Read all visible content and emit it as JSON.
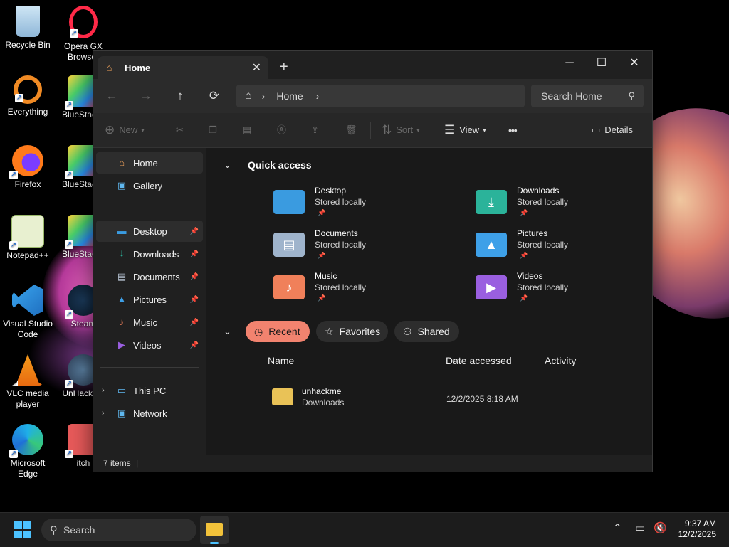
{
  "desktop": {
    "icons": [
      {
        "label": "Recycle Bin",
        "icon": "recycle-bin-icon"
      },
      {
        "label": "Opera GX Browser",
        "icon": "opera-gx-icon"
      },
      {
        "label": "Everything",
        "icon": "everything-search-icon"
      },
      {
        "label": "BlueStacks",
        "icon": "bluestacks-icon"
      },
      {
        "label": "Firefox",
        "icon": "firefox-icon"
      },
      {
        "label": "BlueStacks",
        "icon": "bluestacks-icon"
      },
      {
        "label": "Notepad++",
        "icon": "notepad-plus-plus-icon"
      },
      {
        "label": "BlueStacks",
        "icon": "bluestacks-icon"
      },
      {
        "label": "Visual Studio Code",
        "icon": "vscode-icon"
      },
      {
        "label": "Steam",
        "icon": "steam-icon"
      },
      {
        "label": "VLC media player",
        "icon": "vlc-icon"
      },
      {
        "label": "UnHackMe",
        "icon": "unhackme-icon"
      },
      {
        "label": "Microsoft Edge",
        "icon": "edge-icon"
      },
      {
        "label": "itch",
        "icon": "itch-icon"
      }
    ]
  },
  "explorer": {
    "tab": {
      "title": "Home",
      "close": "✕",
      "new_tab": "+"
    },
    "window_controls": {
      "minimize": "─",
      "maximize": "☐",
      "close": "✕"
    },
    "address": {
      "root": "Home",
      "separator": "›"
    },
    "search": {
      "placeholder": "Search Home"
    },
    "toolbar": {
      "new": "New",
      "sort": "Sort",
      "view": "View",
      "more": "•••",
      "details": "Details"
    },
    "sidebar": {
      "top": [
        {
          "label": "Home",
          "icon": "home-icon"
        },
        {
          "label": "Gallery",
          "icon": "gallery-icon"
        }
      ],
      "pinned": [
        {
          "label": "Desktop",
          "icon": "desktop-folder-icon"
        },
        {
          "label": "Downloads",
          "icon": "downloads-folder-icon"
        },
        {
          "label": "Documents",
          "icon": "documents-folder-icon"
        },
        {
          "label": "Pictures",
          "icon": "pictures-folder-icon"
        },
        {
          "label": "Music",
          "icon": "music-folder-icon"
        },
        {
          "label": "Videos",
          "icon": "videos-folder-icon"
        }
      ],
      "bottom": [
        {
          "label": "This PC",
          "icon": "this-pc-icon"
        },
        {
          "label": "Network",
          "icon": "network-icon"
        }
      ]
    },
    "quick_access": {
      "title": "Quick access",
      "items": [
        {
          "name": "Desktop",
          "status": "Stored locally",
          "color": "#3a9be0"
        },
        {
          "name": "Downloads",
          "status": "Stored locally",
          "color": "#2bb39a"
        },
        {
          "name": "Documents",
          "status": "Stored locally",
          "color": "#9fb4cc"
        },
        {
          "name": "Pictures",
          "status": "Stored locally",
          "color": "#3ea0e8"
        },
        {
          "name": "Music",
          "status": "Stored locally",
          "color": "#f0805a"
        },
        {
          "name": "Videos",
          "status": "Stored locally",
          "color": "#9a5fe0"
        }
      ]
    },
    "recent_tabs": {
      "recent": "Recent",
      "favorites": "Favorites",
      "shared": "Shared"
    },
    "columns": {
      "name": "Name",
      "date": "Date accessed",
      "activity": "Activity"
    },
    "files": [
      {
        "name": "unhackme",
        "location": "Downloads",
        "date": "12/2/2025 8:18 AM"
      }
    ],
    "status": {
      "count": "7 items",
      "sep": "|"
    }
  },
  "taskbar": {
    "search_placeholder": "Search",
    "time": "9:37 AM",
    "date": "12/2/2025"
  },
  "colors": {
    "accent": "#f2836f",
    "start": "#4cc2ff"
  }
}
